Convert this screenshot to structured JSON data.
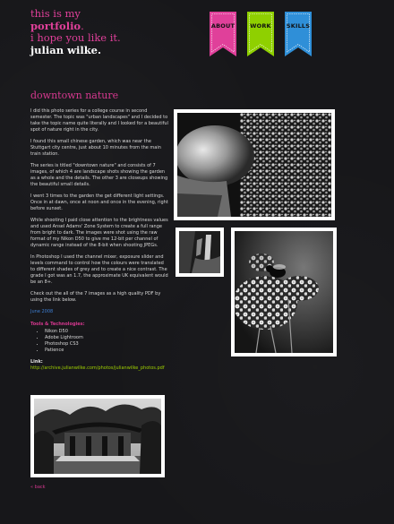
{
  "logo": {
    "line1": "this is my",
    "line2_bold": "portfolio",
    "line2_dot": ".",
    "line3": "i hope you like it.",
    "line4": "julian wilke."
  },
  "nav": [
    {
      "label": "ABOUT",
      "color": "#e0409a"
    },
    {
      "label": "WORK",
      "color": "#8fd000"
    },
    {
      "label": "SKILLS",
      "color": "#2f8fd8"
    }
  ],
  "page_title": "downtown nature",
  "paragraphs": [
    "I did this photo series for a college course in second semester. The topic was \"urban landscapes\" and I decided to take the topic name quite literally and I looked for a beautiful spot of nature right in the city.",
    "I found this small chinese garden, which was near the Stuttgart city centre, just about 10 minutes from the main train station.",
    "The series is titled \"downtown nature\" and consists of 7 images, of which 4 are landscape shots showing the garden as a whole and the details. The other 3 are closeups showing the beautiful small details.",
    "I went 3 times to the garden the get different light settings. Once in at dawn, once at noon and once in the evening, right before sunset.",
    "While shooting I paid close attention to the brightness values and used Ansel Adams' Zone System to create a full range from bright to dark. The images were shot using the raw format of my Nikon D50 to give me 12-bit per channel of dynamic range instead of the 8-bit when shooting JPEGs.",
    "In Photoshop I used the channel mixer, exposure slider and levels command to control how the colours were translated to different shades of grey and to create a nice contrast. The grade I got was an 1.7, the approximate UK equivalent would be an 8+.",
    "Check out the all of the 7 images as a high quality PDF by using the link below."
  ],
  "date": "June 2008",
  "tools_heading": "Tools & Technologies:",
  "tools": [
    "Nikon D50",
    "Adobe Lightroom",
    "Photoshop CS3",
    "Patience"
  ],
  "link_heading": "Link:",
  "link_url": "http://archive.julianwilke.com/photos/julianwilke_photos.pdf",
  "back_label": "« back"
}
